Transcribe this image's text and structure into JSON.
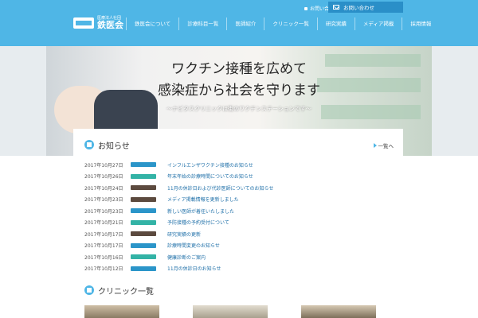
{
  "header": {
    "logo_sub": "医療法人社団",
    "logo_main": "鉄医会",
    "top_link": "お問い合わせ",
    "contact_label": "お問い合わせ",
    "nav": [
      "鉄医会について",
      "診療科目一覧",
      "医師紹介",
      "クリニック一覧",
      "研究実績",
      "メディア掲載",
      "採用情報"
    ]
  },
  "hero": {
    "line1": "ワクチン接種を広めて",
    "line2": "感染症から社会を守ります",
    "subline": "〜ナビタスクリニックは街のワクチンステーションです〜"
  },
  "news": {
    "title": "お知らせ",
    "more_label": "一覧へ",
    "items": [
      {
        "date": "2017年10月27日",
        "tag_color": "#2b95c9",
        "title": "インフルエンザワクチン接種のお知らせ"
      },
      {
        "date": "2017年10月26日",
        "tag_color": "#33b3a6",
        "title": "年末年始の診療時間についてのお知らせ"
      },
      {
        "date": "2017年10月24日",
        "tag_color": "#5c4a3f",
        "title": "11月の休診日および代診医師についてのお知らせ"
      },
      {
        "date": "2017年10月23日",
        "tag_color": "#5c4a3f",
        "title": "メディア掲載情報を更新しました"
      },
      {
        "date": "2017年10月23日",
        "tag_color": "#2b95c9",
        "title": "新しい医師が着任いたしました"
      },
      {
        "date": "2017年10月21日",
        "tag_color": "#33b3a6",
        "title": "予防接種の予約受付について"
      },
      {
        "date": "2017年10月17日",
        "tag_color": "#5c4a3f",
        "title": "研究実績の更新"
      },
      {
        "date": "2017年10月17日",
        "tag_color": "#2b95c9",
        "title": "診療時間変更のお知らせ"
      },
      {
        "date": "2017年10月16日",
        "tag_color": "#33b3a6",
        "title": "健康診断のご案内"
      },
      {
        "date": "2017年10月12日",
        "tag_color": "#2b95c9",
        "title": "11月の休診日のお知らせ"
      }
    ]
  },
  "clinic": {
    "title": "クリニック一覧"
  }
}
